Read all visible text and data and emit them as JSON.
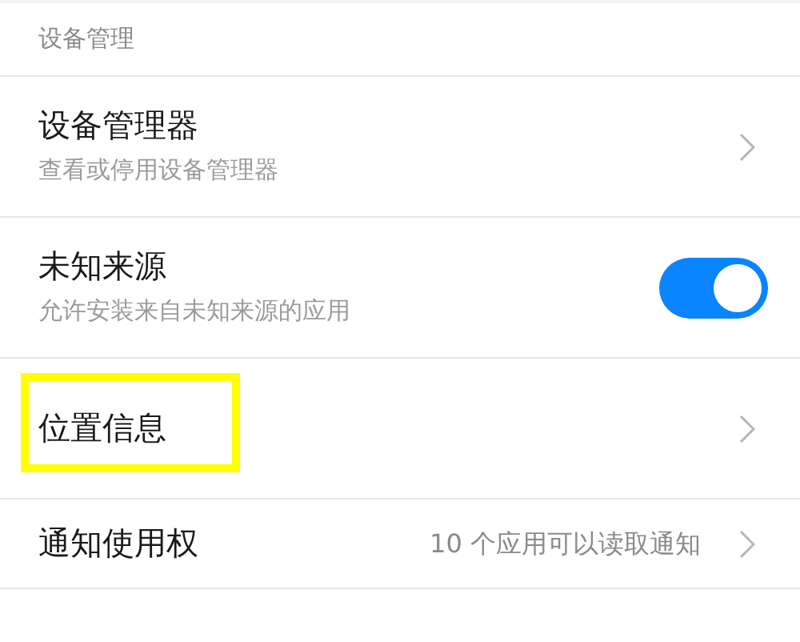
{
  "section_header": "设备管理",
  "items": [
    {
      "kind": "link",
      "title": "设备管理器",
      "subtitle": "查看或停用设备管理器",
      "highlighted": false
    },
    {
      "kind": "toggle",
      "title": "未知来源",
      "subtitle": "允许安装来自未知来源的应用",
      "on": true,
      "highlighted": false
    },
    {
      "kind": "link",
      "title": "位置信息",
      "highlighted": true
    },
    {
      "kind": "link",
      "title": "通知使用权",
      "value": "10 个应用可以读取通知",
      "highlighted": false
    }
  ]
}
